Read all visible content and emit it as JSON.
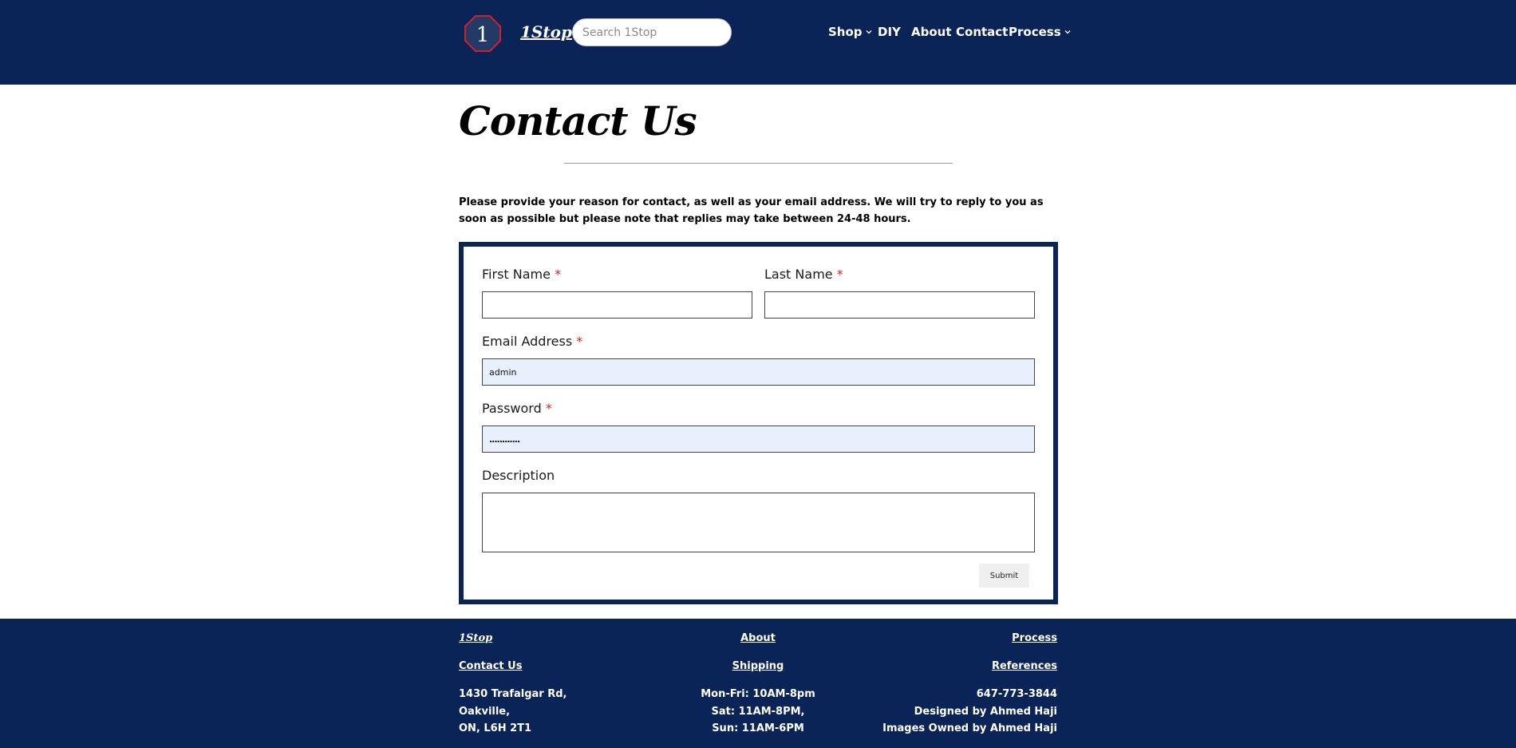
{
  "header": {
    "logo_glyph": "1",
    "brand": "1Stop",
    "search_placeholder": "Search 1Stop",
    "nav": {
      "shop": "Shop",
      "diy": "DIY",
      "about": "About",
      "contact": "Contact",
      "process": "Process"
    },
    "colors": {
      "bar": "#0b2458",
      "logo_fill": "#243a66",
      "logo_border": "#d1202a"
    }
  },
  "page": {
    "title": "Contact Us",
    "intro": "Please provide your reason for contact, as well as your email address. We will try to reply to you as soon as possible but please note that replies may take between 24-48 hours."
  },
  "form": {
    "first_name_label": "First Name",
    "last_name_label": "Last Name",
    "email_label": "Email Address",
    "password_label": "Password",
    "description_label": "Description",
    "required_mark": "*",
    "first_name_value": "",
    "last_name_value": "",
    "email_value": "admin",
    "password_value": "............",
    "description_value": "",
    "submit_label": "Submit"
  },
  "footer": {
    "brand": "1Stop",
    "about": "About",
    "process": "Process",
    "contact": "Contact Us",
    "shipping": "Shipping",
    "references": "References",
    "address": [
      "1430 Trafalgar Rd,",
      "Oakville,",
      "ON, L6H 2T1"
    ],
    "hours": [
      "Mon-Fri: 10AM-8pm",
      "Sat: 11AM-8PM,",
      "Sun: 11AM-6PM"
    ],
    "info": [
      "647-773-3844",
      "Designed by Ahmed Haji",
      "Images Owned by Ahmed Haji"
    ]
  }
}
